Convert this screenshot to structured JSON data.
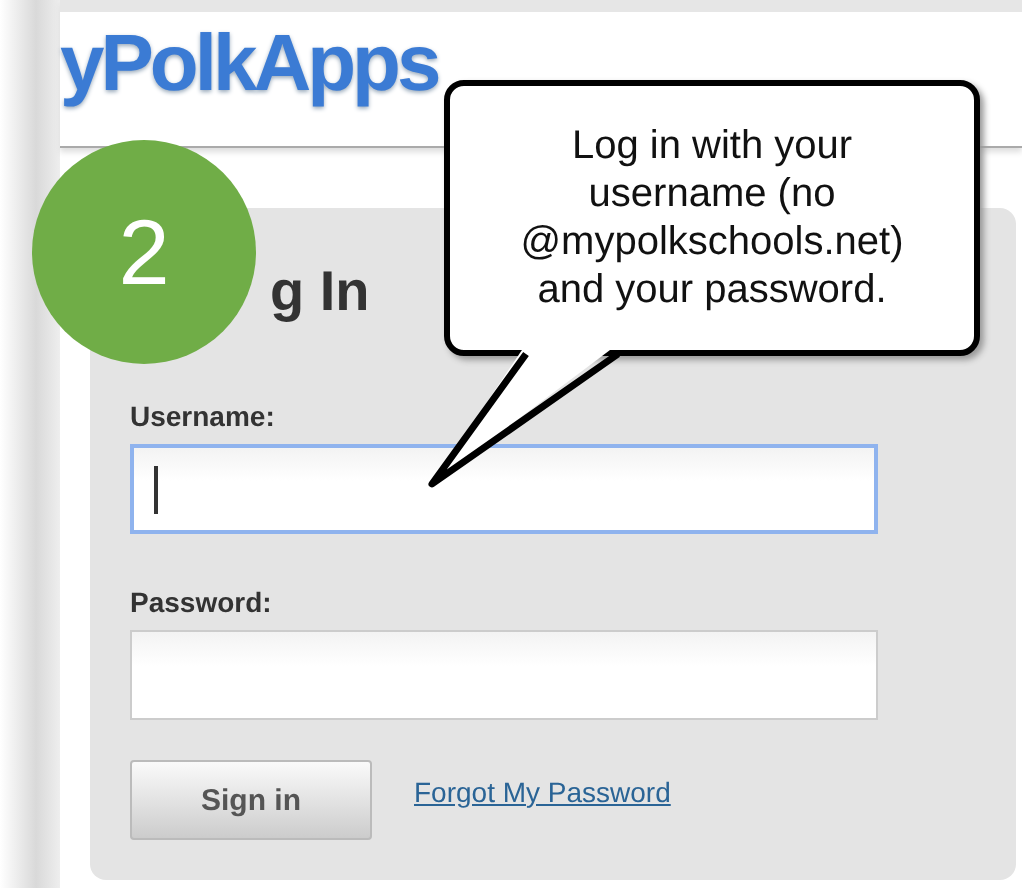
{
  "logo": "yPolkApps",
  "step_badge": "2",
  "callout": "Log in with your username (no @mypolkschools.net) and your password.",
  "heading": "g In",
  "fields": [
    {
      "label": "Username:",
      "focused": true
    },
    {
      "label": "Password:",
      "focused": false
    }
  ],
  "sign_in_button": "Sign in",
  "forgot_link": "Forgot My Password"
}
